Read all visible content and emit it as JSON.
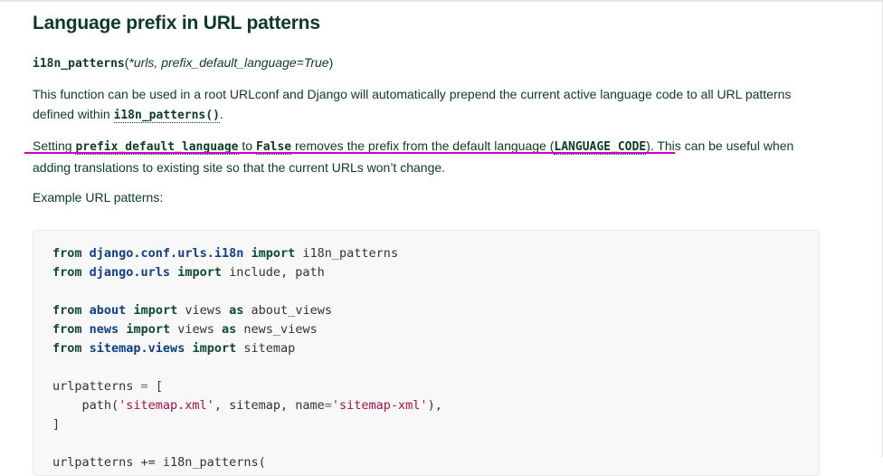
{
  "heading": "Language prefix in URL patterns",
  "signature": {
    "func": "i18n_patterns",
    "open": "(",
    "params": "*urls, prefix_default_language=True",
    "close": ")"
  },
  "para1": {
    "text": "This function can be used in a root URLconf and Django will automatically prepend the current active language code to all URL patterns defined within ",
    "code": "i18n_patterns()",
    "end": "."
  },
  "para2": {
    "t1": "Setting ",
    "c1": "prefix_default_language",
    "t2": " to ",
    "c2": "False",
    "t3": " removes the prefix from the default language (",
    "c3": "LANGUAGE_CODE",
    "t4": "). This can be useful when adding translations to existing site so that the current URLs won’t change."
  },
  "para3": "Example URL patterns:",
  "code": {
    "l1": {
      "k1": "from",
      "m": "django.conf.urls.i18n",
      "k2": "import",
      "r": "i18n_patterns"
    },
    "l2": {
      "k1": "from",
      "m": "django.urls",
      "k2": "import",
      "r": "include, path"
    },
    "l4": {
      "k1": "from",
      "m": "about",
      "k2": "import",
      "r": "views",
      "k3": "as",
      "r2": "about_views"
    },
    "l5": {
      "k1": "from",
      "m": "news",
      "k2": "import",
      "r": "views",
      "k3": "as",
      "r2": "news_views"
    },
    "l6": {
      "k1": "from",
      "m": "sitemap.views",
      "k2": "import",
      "r": "sitemap"
    },
    "l8": {
      "a": "urlpatterns",
      "op": "=",
      "b": "["
    },
    "l9": {
      "a": "path(",
      "s1": "'sitemap.xml'",
      "b": ", sitemap, name",
      "op": "=",
      "s2": "'sitemap-xml'",
      "c": "),"
    },
    "l10": "]",
    "l12": "urlpatterns += i18n_patterns("
  },
  "colors": {
    "text": "#0c3c26",
    "keyword": "#0c4b33",
    "module": "#0f3f88",
    "string": "#aa1144",
    "highlight": "#d400c0",
    "code_bg": "#f8f8f8"
  }
}
